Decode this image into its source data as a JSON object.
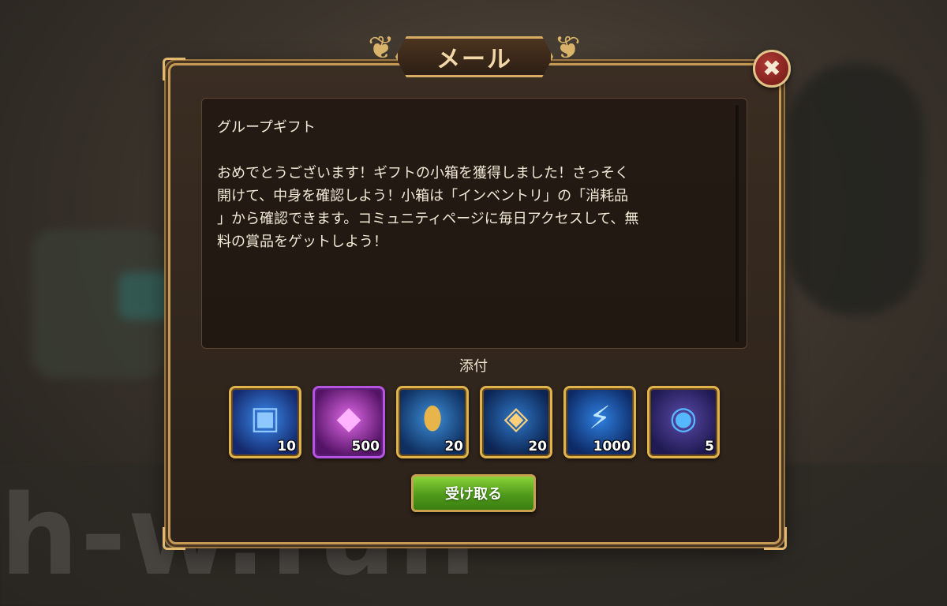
{
  "watermark": "h-w.fun",
  "dialog": {
    "title": "メール",
    "close_icon": "close-x-icon"
  },
  "message": {
    "subject": "グループギフト",
    "body": "おめでとうございます！ギフトの小箱を獲得しました！さっそく\n開けて、中身を確認しよう！小箱は「インベントリ」の「消耗品\n」から確認できます。コミュニティページに毎日アクセスして、無\n料の賞品をゲットしよう！"
  },
  "attachments": {
    "label": "添付",
    "items": [
      {
        "icon": "blue-gift-box-icon",
        "quantity": "10",
        "frame": "gold"
      },
      {
        "icon": "pink-cube-icon",
        "quantity": "500",
        "frame": "purple"
      },
      {
        "icon": "golden-egg-icon",
        "quantity": "20",
        "frame": "gold"
      },
      {
        "icon": "crystal-eye-icon",
        "quantity": "20",
        "frame": "gold"
      },
      {
        "icon": "lightning-energy-icon",
        "quantity": "1000",
        "frame": "gold"
      },
      {
        "icon": "blue-orb-ring-icon",
        "quantity": "5",
        "frame": "gold"
      }
    ]
  },
  "claim_button": {
    "label": "受け取る"
  },
  "colors": {
    "frame_gold": "#c59a57",
    "claim_green": "#5aa620",
    "close_red": "#8f2420",
    "text_cream": "#f3e8d6"
  }
}
